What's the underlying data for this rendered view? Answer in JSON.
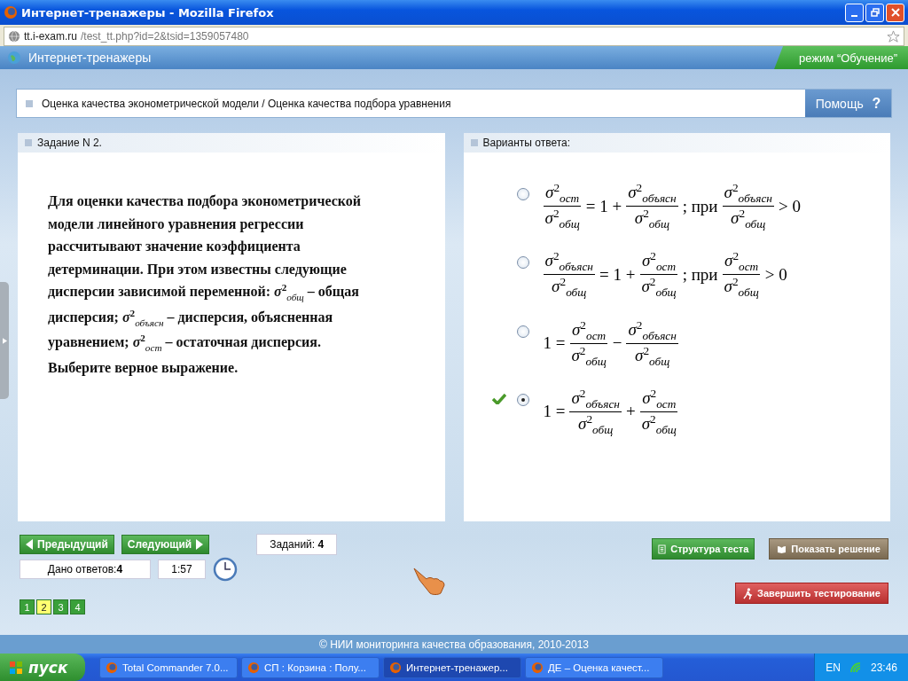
{
  "window": {
    "title": "Интернет-тренажеры - Mozilla Firefox"
  },
  "address_bar": {
    "host": "tt.i-exam.ru",
    "path": "/test_tt.php?id=2&tsid=1359057480"
  },
  "app_header": {
    "title": "Интернет-тренажеры",
    "mode": "режим “Обучение”"
  },
  "breadcrumb": {
    "text": "Оценка качества эконометрической модели / Оценка качества подбора уравнения",
    "help": "Помощь",
    "help_icon": "?"
  },
  "task": {
    "heading": "Задание N 2.",
    "text": "Для оценки качества подбора эконометрической модели линейного уравнения регрессии рассчитывают значение коэффициента детерминации. При этом известны следующие дисперсии зависимой переменной: *σ*$^{2}$$_{общ}$ – общая дисперсия; *σ*$^{2}$$_{объясн}$ – дисперсия, объясненная уравнением; *σ*$^{2}$$_{ост}$ – остаточная дисперсия. Выберите верное выражение."
  },
  "answers_panel": {
    "heading": "Варианты ответа:"
  },
  "answers": [
    {
      "selected": false,
      "correct": false,
      "parts": [
        {
          "kind": "frac",
          "num": "σ$^{2}$$_{ост}$",
          "den": "σ$^{2}$$_{общ}$"
        },
        {
          "kind": "text",
          "text": "= 1 +"
        },
        {
          "kind": "frac",
          "num": "σ$^{2}$$_{объясн}$",
          "den": "σ$^{2}$$_{общ}$"
        },
        {
          "kind": "text",
          "text": "; при"
        },
        {
          "kind": "frac",
          "num": "σ$^{2}$$_{объясн}$",
          "den": "σ$^{2}$$_{общ}$"
        },
        {
          "kind": "text",
          "text": "> 0"
        }
      ]
    },
    {
      "selected": false,
      "correct": false,
      "parts": [
        {
          "kind": "frac",
          "num": "σ$^{2}$$_{объясн}$",
          "den": "σ$^{2}$$_{общ}$"
        },
        {
          "kind": "text",
          "text": "= 1 +"
        },
        {
          "kind": "frac",
          "num": "σ$^{2}$$_{ост}$",
          "den": "σ$^{2}$$_{общ}$"
        },
        {
          "kind": "text",
          "text": "; при"
        },
        {
          "kind": "frac",
          "num": "σ$^{2}$$_{ост}$",
          "den": "σ$^{2}$$_{общ}$"
        },
        {
          "kind": "text",
          "text": "> 0"
        }
      ]
    },
    {
      "selected": false,
      "correct": false,
      "parts": [
        {
          "kind": "text",
          "text": "1 ="
        },
        {
          "kind": "frac",
          "num": "σ$^{2}$$_{ост}$",
          "den": "σ$^{2}$$_{общ}$"
        },
        {
          "kind": "text",
          "text": "−"
        },
        {
          "kind": "frac",
          "num": "σ$^{2}$$_{объясн}$",
          "den": "σ$^{2}$$_{общ}$"
        }
      ]
    },
    {
      "selected": true,
      "correct": true,
      "parts": [
        {
          "kind": "text",
          "text": "1 ="
        },
        {
          "kind": "frac",
          "num": "σ$^{2}$$_{объясн}$",
          "den": "σ$^{2}$$_{общ}$"
        },
        {
          "kind": "text",
          "text": "+"
        },
        {
          "kind": "frac",
          "num": "σ$^{2}$$_{ост}$",
          "den": "σ$^{2}$$_{общ}$"
        }
      ]
    }
  ],
  "navigation": {
    "prev": "Предыдущий",
    "next": "Следующий",
    "tasks_count": "Заданий: **4**",
    "answered": "Дано ответов:**4**",
    "timer": "1:57"
  },
  "pages": [
    {
      "label": "1",
      "selected": false
    },
    {
      "label": "2",
      "selected": true
    },
    {
      "label": "3",
      "selected": false
    },
    {
      "label": "4",
      "selected": false
    }
  ],
  "actions": {
    "structure": "Структура теста",
    "solution": "Показать решение",
    "finish": "Завершить тестирование"
  },
  "footer": {
    "text": "© НИИ мониторинга качества образования, 2010-2013"
  },
  "taskbar": {
    "start": "пуск",
    "tasks": [
      {
        "label": "Total Commander 7.0...",
        "selected": false
      },
      {
        "label": "СП : Корзина : Полу...",
        "selected": false
      },
      {
        "label": "Интернет-тренажер...",
        "selected": true
      },
      {
        "label": "ДЕ – Оценка качест...",
        "selected": false
      }
    ],
    "language": "EN",
    "clock": "23:46"
  }
}
